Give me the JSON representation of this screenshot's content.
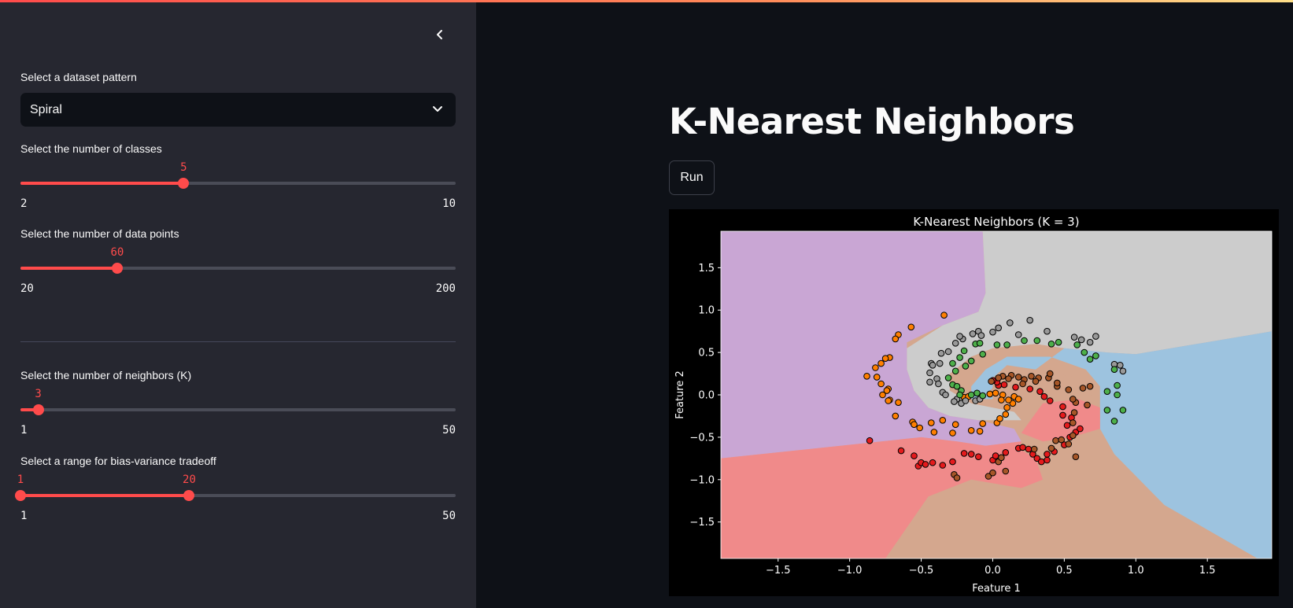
{
  "sidebar": {
    "dataset_label": "Select a dataset pattern",
    "dataset_value": "Spiral",
    "classes": {
      "label": "Select the number of classes",
      "value": "5",
      "min": "2",
      "max": "10",
      "fraction": 0.375
    },
    "points": {
      "label": "Select the number of data points",
      "value": "60",
      "min": "20",
      "max": "200",
      "fraction": 0.2222
    },
    "neighbors": {
      "label": "Select the number of neighbors (K)",
      "value": "3",
      "min": "1",
      "max": "50",
      "fraction": 0.0408
    },
    "range": {
      "label": "Select a range for bias-variance tradeoff",
      "low": "1",
      "high": "20",
      "min": "1",
      "max": "50",
      "low_fraction": 0.0,
      "high_fraction": 0.3878
    }
  },
  "main": {
    "title": "K-Nearest Neighbors",
    "run_label": "Run"
  },
  "chart_data": {
    "type": "scatter",
    "title": "K-Nearest Neighbors (K = 3)",
    "xlabel": "Feature 1",
    "ylabel": "Feature 2",
    "xlim": [
      -1.9,
      1.95
    ],
    "ylim": [
      -1.93,
      1.93
    ],
    "xticks": [
      "−1.5",
      "−1.0",
      "−0.5",
      "0.0",
      "0.5",
      "1.0",
      "1.5"
    ],
    "xtick_values": [
      -1.5,
      -1.0,
      -0.5,
      0.0,
      0.5,
      1.0,
      1.5
    ],
    "yticks": [
      "1.5",
      "1.0",
      "0.5",
      "0.0",
      "−0.5",
      "−1.0",
      "−1.5"
    ],
    "ytick_values": [
      1.5,
      1.0,
      0.5,
      0.0,
      -0.5,
      -1.0,
      -1.5
    ],
    "grid": false,
    "background": "#000000",
    "colors": {
      "orange": "#ff7f00",
      "gray": "#999999",
      "green": "#4daf4a",
      "red": "#e41a1c",
      "brown": "#a65628"
    },
    "regions": {
      "purple": "#c9a6d4",
      "gray": "#cccccc",
      "blue": "#9dc3df",
      "red": "#f08a8a",
      "brown": "#d4a78e"
    },
    "series": [
      {
        "name": "orange",
        "color": "#ff7f00",
        "points": [
          [
            -0.34,
            0.94
          ],
          [
            -0.57,
            0.8
          ],
          [
            -0.66,
            0.71
          ],
          [
            -0.68,
            0.66
          ],
          [
            -0.72,
            0.44
          ],
          [
            -0.75,
            0.43
          ],
          [
            -0.78,
            0.37
          ],
          [
            -0.82,
            0.32
          ],
          [
            -0.88,
            0.22
          ],
          [
            -0.81,
            0.21
          ],
          [
            -0.78,
            0.13
          ],
          [
            -0.73,
            0.07
          ],
          [
            -0.74,
            0.05
          ],
          [
            -0.77,
            0.0
          ],
          [
            -0.72,
            -0.06
          ],
          [
            -0.73,
            -0.07
          ],
          [
            -0.66,
            -0.09
          ],
          [
            -0.68,
            -0.25
          ],
          [
            -0.56,
            -0.32
          ],
          [
            -0.55,
            -0.35
          ],
          [
            -0.51,
            -0.39
          ],
          [
            -0.43,
            -0.33
          ],
          [
            -0.41,
            -0.44
          ],
          [
            -0.35,
            -0.3
          ],
          [
            -0.28,
            -0.45
          ],
          [
            -0.26,
            -0.35
          ],
          [
            -0.15,
            -0.42
          ],
          [
            -0.09,
            -0.43
          ],
          [
            -0.07,
            -0.34
          ],
          [
            0.03,
            -0.33
          ],
          [
            0.05,
            -0.28
          ],
          [
            0.09,
            -0.23
          ],
          [
            0.1,
            -0.15
          ],
          [
            0.14,
            -0.1
          ],
          [
            0.15,
            -0.02
          ],
          [
            0.07,
            0.0
          ],
          [
            0.02,
            0.02
          ],
          [
            -0.02,
            0.01
          ],
          [
            0.06,
            -0.06
          ],
          [
            -0.2,
            -0.03
          ],
          [
            -0.17,
            -0.02
          ],
          [
            0.18,
            -0.05
          ],
          [
            0.11,
            -0.06
          ]
        ]
      },
      {
        "name": "gray",
        "color": "#999999",
        "points": [
          [
            0.12,
            0.85
          ],
          [
            0.04,
            0.79
          ],
          [
            0.0,
            0.74
          ],
          [
            -0.1,
            0.75
          ],
          [
            -0.08,
            0.7
          ],
          [
            -0.14,
            0.72
          ],
          [
            -0.21,
            0.66
          ],
          [
            -0.23,
            0.69
          ],
          [
            -0.26,
            0.61
          ],
          [
            -0.31,
            0.51
          ],
          [
            -0.36,
            0.49
          ],
          [
            -0.37,
            0.37
          ],
          [
            -0.43,
            0.37
          ],
          [
            -0.42,
            0.35
          ],
          [
            -0.44,
            0.26
          ],
          [
            -0.39,
            0.19
          ],
          [
            -0.44,
            0.15
          ],
          [
            -0.38,
            0.13
          ],
          [
            -0.35,
            0.03
          ],
          [
            -0.33,
            0.0
          ],
          [
            -0.25,
            -0.05
          ],
          [
            -0.27,
            -0.08
          ],
          [
            -0.22,
            -0.1
          ],
          [
            -0.19,
            -0.07
          ],
          [
            -0.12,
            -0.07
          ],
          [
            -0.09,
            -0.05
          ],
          [
            0.26,
            0.88
          ],
          [
            0.38,
            0.75
          ],
          [
            0.57,
            0.68
          ],
          [
            0.62,
            0.65
          ],
          [
            0.72,
            0.69
          ],
          [
            0.85,
            0.36
          ],
          [
            0.89,
            0.35
          ],
          [
            0.91,
            0.28
          ],
          [
            0.68,
            0.62
          ],
          [
            0.18,
            0.71
          ]
        ]
      },
      {
        "name": "green",
        "color": "#4daf4a",
        "points": [
          [
            -0.2,
            0.52
          ],
          [
            -0.15,
            0.4
          ],
          [
            -0.19,
            0.34
          ],
          [
            -0.23,
            0.44
          ],
          [
            -0.28,
            0.37
          ],
          [
            -0.26,
            0.28
          ],
          [
            -0.31,
            0.2
          ],
          [
            -0.28,
            0.12
          ],
          [
            -0.25,
            0.1
          ],
          [
            -0.22,
            0.05
          ],
          [
            -0.23,
            0.0
          ],
          [
            -0.15,
            0.0
          ],
          [
            -0.11,
            0.02
          ],
          [
            -0.07,
            -0.01
          ],
          [
            -0.12,
            0.6
          ],
          [
            -0.09,
            0.61
          ],
          [
            -0.07,
            0.48
          ],
          [
            0.03,
            0.59
          ],
          [
            0.1,
            0.59
          ],
          [
            0.22,
            0.64
          ],
          [
            0.31,
            0.64
          ],
          [
            0.41,
            0.6
          ],
          [
            0.46,
            0.62
          ],
          [
            0.59,
            0.59
          ],
          [
            0.64,
            0.5
          ],
          [
            0.72,
            0.46
          ],
          [
            0.68,
            0.42
          ],
          [
            0.85,
            0.3
          ],
          [
            0.8,
            0.04
          ],
          [
            0.8,
            -0.18
          ],
          [
            0.85,
            -0.31
          ],
          [
            0.91,
            -0.18
          ],
          [
            0.87,
            0.11
          ],
          [
            0.87,
            0.0
          ]
        ]
      },
      {
        "name": "red",
        "color": "#e41a1c",
        "points": [
          [
            -0.86,
            -0.54
          ],
          [
            -0.64,
            -0.66
          ],
          [
            -0.55,
            -0.72
          ],
          [
            -0.52,
            -0.84
          ],
          [
            -0.5,
            -0.8
          ],
          [
            -0.47,
            -0.82
          ],
          [
            -0.42,
            -0.8
          ],
          [
            -0.35,
            -0.83
          ],
          [
            -0.28,
            -0.79
          ],
          [
            -0.2,
            -0.69
          ],
          [
            -0.15,
            -0.7
          ],
          [
            -0.1,
            -0.73
          ],
          [
            0.0,
            -0.77
          ],
          [
            0.02,
            -0.72
          ],
          [
            0.09,
            -0.68
          ],
          [
            0.18,
            -0.63
          ],
          [
            0.21,
            -0.62
          ],
          [
            0.25,
            -0.64
          ],
          [
            0.28,
            -0.7
          ],
          [
            0.31,
            -0.75
          ],
          [
            0.34,
            -0.79
          ],
          [
            0.38,
            -0.77
          ],
          [
            0.38,
            -0.7
          ],
          [
            0.43,
            -0.67
          ],
          [
            0.5,
            -0.59
          ],
          [
            0.54,
            -0.5
          ],
          [
            0.58,
            -0.44
          ],
          [
            0.61,
            -0.4
          ],
          [
            0.52,
            -0.36
          ],
          [
            0.55,
            -0.27
          ],
          [
            0.49,
            -0.24
          ],
          [
            0.49,
            -0.14
          ],
          [
            0.4,
            -0.07
          ],
          [
            0.36,
            -0.02
          ],
          [
            0.33,
            0.04
          ],
          [
            0.26,
            0.07
          ],
          [
            0.16,
            0.09
          ],
          [
            0.08,
            0.12
          ],
          [
            0.04,
            0.11
          ],
          [
            0.03,
            0.15
          ],
          [
            0.0,
            0.17
          ]
        ]
      },
      {
        "name": "brown",
        "color": "#a65628",
        "points": [
          [
            -0.27,
            -0.94
          ],
          [
            -0.25,
            -0.98
          ],
          [
            -0.03,
            -0.96
          ],
          [
            0.0,
            -0.92
          ],
          [
            0.04,
            -0.79
          ],
          [
            0.06,
            -0.74
          ],
          [
            0.09,
            -0.9
          ],
          [
            0.29,
            -0.64
          ],
          [
            0.41,
            -0.63
          ],
          [
            0.44,
            -0.54
          ],
          [
            0.48,
            -0.53
          ],
          [
            0.53,
            -0.58
          ],
          [
            0.58,
            -0.73
          ],
          [
            0.56,
            -0.48
          ],
          [
            0.56,
            -0.33
          ],
          [
            0.57,
            -0.21
          ],
          [
            0.58,
            -0.09
          ],
          [
            0.56,
            -0.05
          ],
          [
            0.63,
            0.08
          ],
          [
            0.68,
            0.1
          ],
          [
            0.66,
            -0.12
          ],
          [
            0.53,
            0.06
          ],
          [
            0.45,
            0.1
          ],
          [
            0.45,
            0.14
          ],
          [
            0.39,
            0.2
          ],
          [
            0.4,
            0.25
          ],
          [
            0.32,
            0.2
          ],
          [
            0.3,
            0.16
          ],
          [
            0.22,
            0.18
          ],
          [
            0.18,
            0.21
          ],
          [
            0.13,
            0.23
          ],
          [
            0.07,
            0.22
          ],
          [
            0.04,
            0.2
          ],
          [
            -0.01,
            0.16
          ],
          [
            0.11,
            0.19
          ],
          [
            0.27,
            0.22
          ],
          [
            0.21,
            0.13
          ]
        ]
      }
    ]
  }
}
